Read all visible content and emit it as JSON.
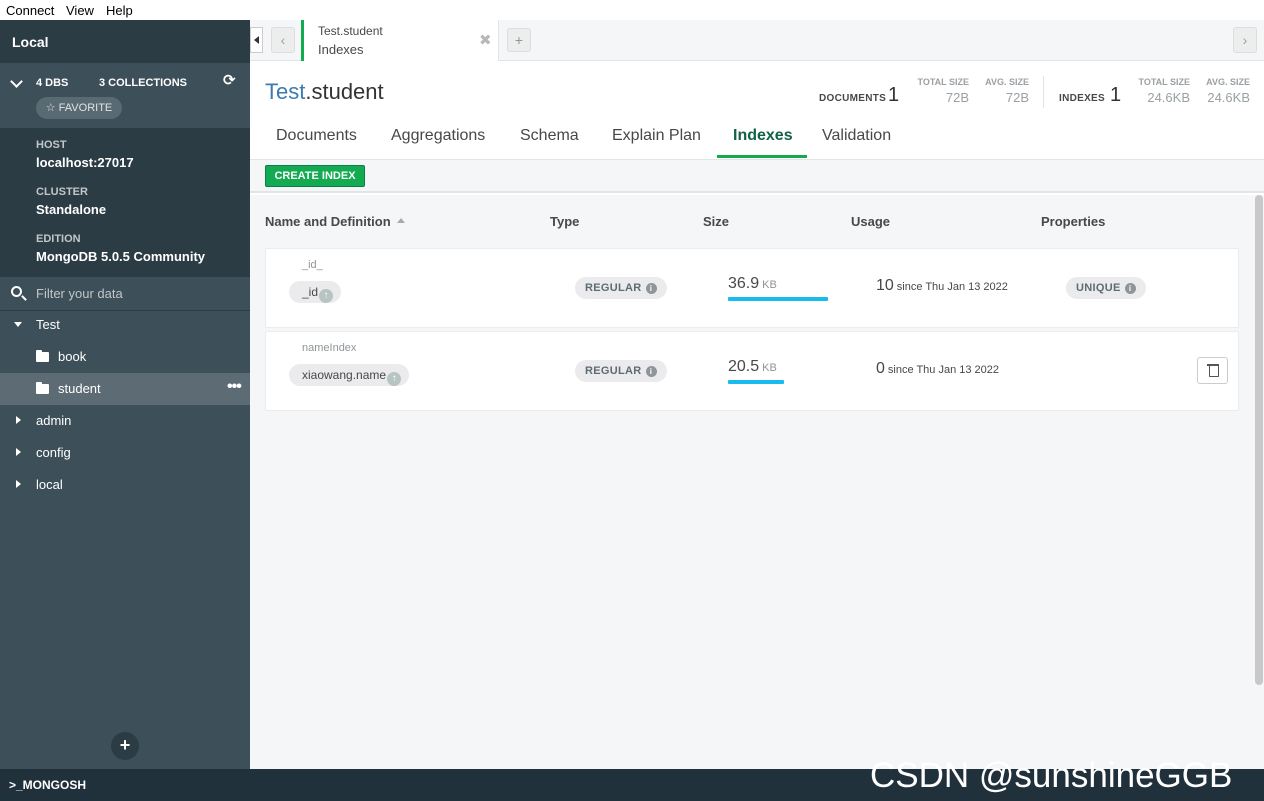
{
  "menu": {
    "connect": "Connect",
    "view": "View",
    "help": "Help"
  },
  "sidebar": {
    "title": "Local",
    "dbs_count": "4 DBS",
    "collections_count": "3 COLLECTIONS",
    "favorite_label": "☆ FAVORITE",
    "host_label": "HOST",
    "host_value": "localhost:27017",
    "cluster_label": "CLUSTER",
    "cluster_value": "Standalone",
    "edition_label": "EDITION",
    "edition_value": "MongoDB 5.0.5 Community",
    "filter_placeholder": "Filter your data",
    "databases": [
      {
        "name": "Test",
        "expanded": true,
        "collections": [
          "book",
          "student"
        ]
      },
      {
        "name": "admin",
        "expanded": false
      },
      {
        "name": "config",
        "expanded": false
      },
      {
        "name": "local",
        "expanded": false
      }
    ],
    "active_collection": "student"
  },
  "tab": {
    "namespace": "Test.student",
    "subtitle": "Indexes"
  },
  "header": {
    "db": "Test",
    "collection": ".student",
    "documents_label": "DOCUMENTS",
    "documents_count": "1",
    "doc_total_size_label": "TOTAL SIZE",
    "doc_total_size": "72B",
    "doc_avg_size_label": "AVG. SIZE",
    "doc_avg_size": "72B",
    "indexes_label": "INDEXES",
    "indexes_count": "1",
    "idx_total_size_label": "TOTAL SIZE",
    "idx_total_size": "24.6KB",
    "idx_avg_size_label": "AVG. SIZE",
    "idx_avg_size": "24.6KB",
    "tabs": [
      "Documents",
      "Aggregations",
      "Schema",
      "Explain Plan",
      "Indexes",
      "Validation"
    ],
    "active_tab": "Indexes"
  },
  "toolbar": {
    "create_index": "CREATE INDEX"
  },
  "table": {
    "columns": [
      "Name and Definition",
      "Type",
      "Size",
      "Usage",
      "Properties"
    ],
    "rows": [
      {
        "name": "_id_",
        "key": "_id",
        "type": "REGULAR",
        "size_value": "36.9",
        "size_unit": "KB",
        "size_fraction": 1.0,
        "usage_count": "10",
        "usage_since": "since Thu Jan 13 2022",
        "property": "UNIQUE"
      },
      {
        "name": "nameIndex",
        "key": "xiaowang.name",
        "type": "REGULAR",
        "size_value": "20.5",
        "size_unit": "KB",
        "size_fraction": 0.56,
        "usage_count": "0",
        "usage_since": "since Thu Jan 13 2022",
        "property": ""
      }
    ]
  },
  "shell": {
    "label": ">_MONGOSH"
  },
  "watermark": "CSDN @sunshineGGB",
  "colors": {
    "accent_green": "#13aa52",
    "sidebar_bg": "#3d4f58",
    "size_bar": "#19baee",
    "db_blue": "#3b7bb0"
  }
}
